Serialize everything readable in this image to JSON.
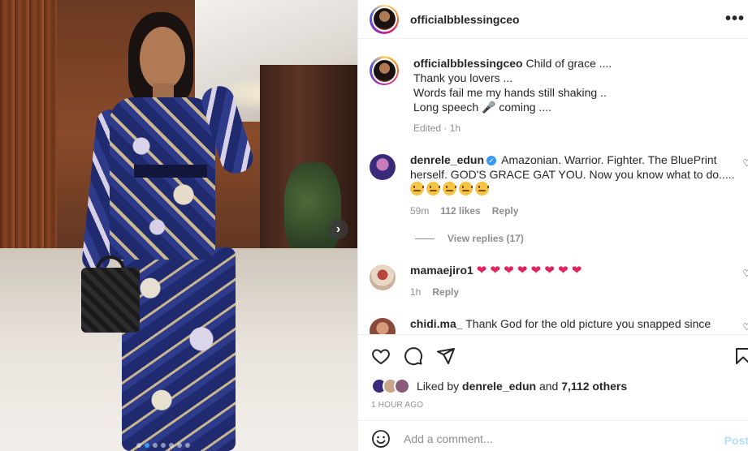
{
  "post": {
    "author": "officialbblessingceo",
    "more_icon": "more-horizontal-icon",
    "carousel": {
      "current_index": 1,
      "total": 7
    }
  },
  "caption": {
    "username": "officialbblessingceo",
    "lines": [
      "Child of grace ....",
      "Thank you lovers ...",
      "Words fail me my hands still shaking ..",
      "Long speech 🎤 coming ...."
    ],
    "edited": "Edited",
    "time": "1h"
  },
  "comments": [
    {
      "username": "denrele_edun",
      "verified": true,
      "text_line1": "Amazonian. Warrior. Fighter. The BluePrint",
      "text_line2": "herself. GOD'S GRACE GAT YOU. Now you know what to do.....",
      "emoji_count": 5,
      "time": "59m",
      "likes": "112 likes",
      "reply": "Reply",
      "view_replies": "View replies (17)"
    },
    {
      "username": "mamaejiro1",
      "hearts": "❤ ❤ ❤ ❤ ❤ ❤ ❤ ❤",
      "time": "1h",
      "reply": "Reply"
    },
    {
      "username": "chidi.ma_",
      "text": "Thank God for the old picture you snapped since"
    }
  ],
  "likes": {
    "prefix": "Liked by",
    "first_liker": "denrele_edun",
    "and": "and",
    "others": "7,112 others"
  },
  "timestamp": "1 HOUR AGO",
  "add_comment": {
    "placeholder": "Add a comment...",
    "post_label": "Post"
  },
  "colors": {
    "accent": "#3897f0",
    "post_disabled": "#b2dffc",
    "secondary_text": "#8e8e8e",
    "heart_red": "#e0245e"
  }
}
